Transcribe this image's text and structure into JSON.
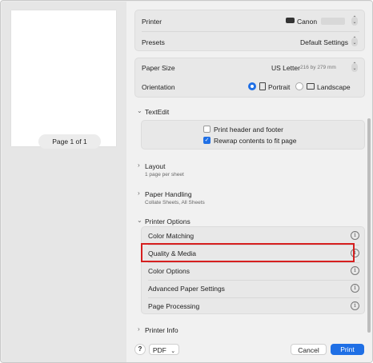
{
  "preview": {
    "page_indicator": "Page 1 of 1"
  },
  "printer": {
    "label": "Printer",
    "value": "Canon",
    "stepper": "⌃⌄",
    "icon": "printer-icon"
  },
  "presets": {
    "label": "Presets",
    "value": "Default Settings"
  },
  "paper_size": {
    "label": "Paper Size",
    "value": "US Letter",
    "detail": "216 by 279 mm"
  },
  "orientation": {
    "label": "Orientation",
    "options": [
      {
        "label": "Portrait",
        "selected": true
      },
      {
        "label": "Landscape",
        "selected": false
      }
    ]
  },
  "textedit": {
    "title": "TextEdit",
    "options": [
      {
        "label": "Print header and footer",
        "checked": false
      },
      {
        "label": "Rewrap contents to fit page",
        "checked": true
      }
    ]
  },
  "layout": {
    "title": "Layout",
    "subtitle": "1 page per sheet"
  },
  "paper_handling": {
    "title": "Paper Handling",
    "subtitle": "Collate Sheets, All Sheets"
  },
  "printer_options": {
    "title": "Printer Options",
    "items": [
      {
        "label": "Color Matching"
      },
      {
        "label": "Quality & Media"
      },
      {
        "label": "Color Options"
      },
      {
        "label": "Advanced Paper Settings"
      },
      {
        "label": "Page Processing"
      }
    ]
  },
  "printer_info": {
    "title": "Printer Info"
  },
  "footer": {
    "help": "?",
    "pdf_label": "PDF",
    "cancel_label": "Cancel",
    "print_label": "Print"
  },
  "colors": {
    "accent": "#1f6fe5",
    "highlight": "#d61f1f"
  }
}
